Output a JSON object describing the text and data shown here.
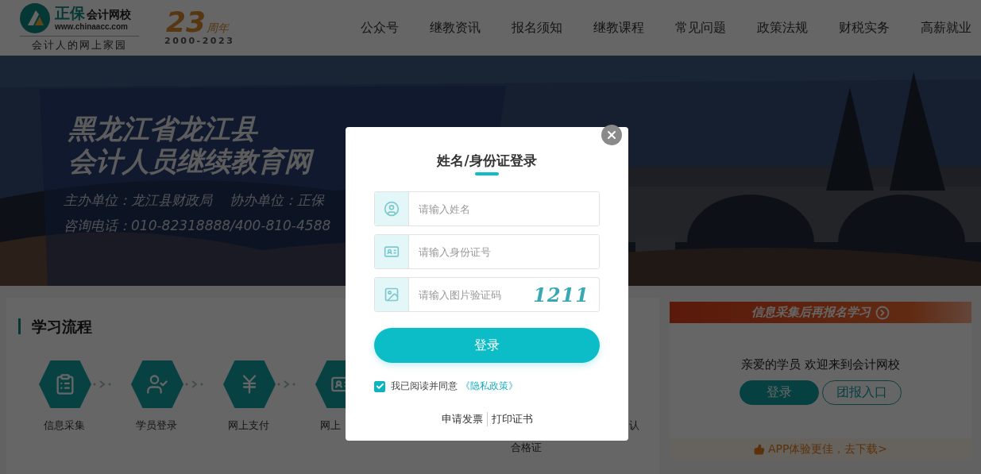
{
  "header": {
    "logo": {
      "brand": "正保",
      "name": "会计网校",
      "url": "www.chinaacc.com",
      "slogan": "会计人的网上家园"
    },
    "anniversary": {
      "number": "23",
      "suffix": "周年",
      "years": "2000-2023"
    },
    "nav": [
      "公众号",
      "继教资讯",
      "报名须知",
      "继教课程",
      "常见问题",
      "政策法规",
      "财税实务",
      "高薪就业"
    ]
  },
  "banner": {
    "title_lines": [
      "黑龙江省龙江县",
      "会计人员继续教育网"
    ],
    "info_lines": [
      [
        "主办单位：龙江县财政局",
        "协办单位：正保"
      ],
      [
        "咨询电话：010-82318888/400-810-4588"
      ]
    ]
  },
  "process": {
    "title": "学习流程",
    "steps": [
      {
        "kind": "clipboard",
        "label": "信息采集"
      },
      {
        "kind": "user-check",
        "label": "学员登录"
      },
      {
        "kind": "yen",
        "label": "网上支付"
      },
      {
        "kind": "id-card",
        "label": "网上"
      },
      {
        "kind": "hidden"
      },
      {
        "kind": "lower-label",
        "label": "合格证"
      },
      {
        "kind": "label-only",
        "label": "认"
      }
    ]
  },
  "side": {
    "banner": "信息采集后再报名学习",
    "welcome": "亲爱的学员 欢迎来到会计网校",
    "buttons": [
      {
        "label": "登录",
        "kind": "primary"
      },
      {
        "label": "团报入口",
        "kind": "outline"
      }
    ],
    "app_link": "APP体验更佳，去下载>"
  },
  "modal": {
    "title": "姓名/身份证登录",
    "fields": [
      {
        "kind": "name",
        "placeholder": "请输入姓名"
      },
      {
        "kind": "id",
        "placeholder": "请输入身份证号"
      },
      {
        "kind": "captcha",
        "placeholder": "请输入图片验证码",
        "captcha": "1211"
      }
    ],
    "submit": "登录",
    "agreement": {
      "checked": true,
      "text": "我已阅读并同意",
      "link": "《隐私政策》"
    },
    "links": [
      "申请发票",
      "打印证书"
    ]
  }
}
